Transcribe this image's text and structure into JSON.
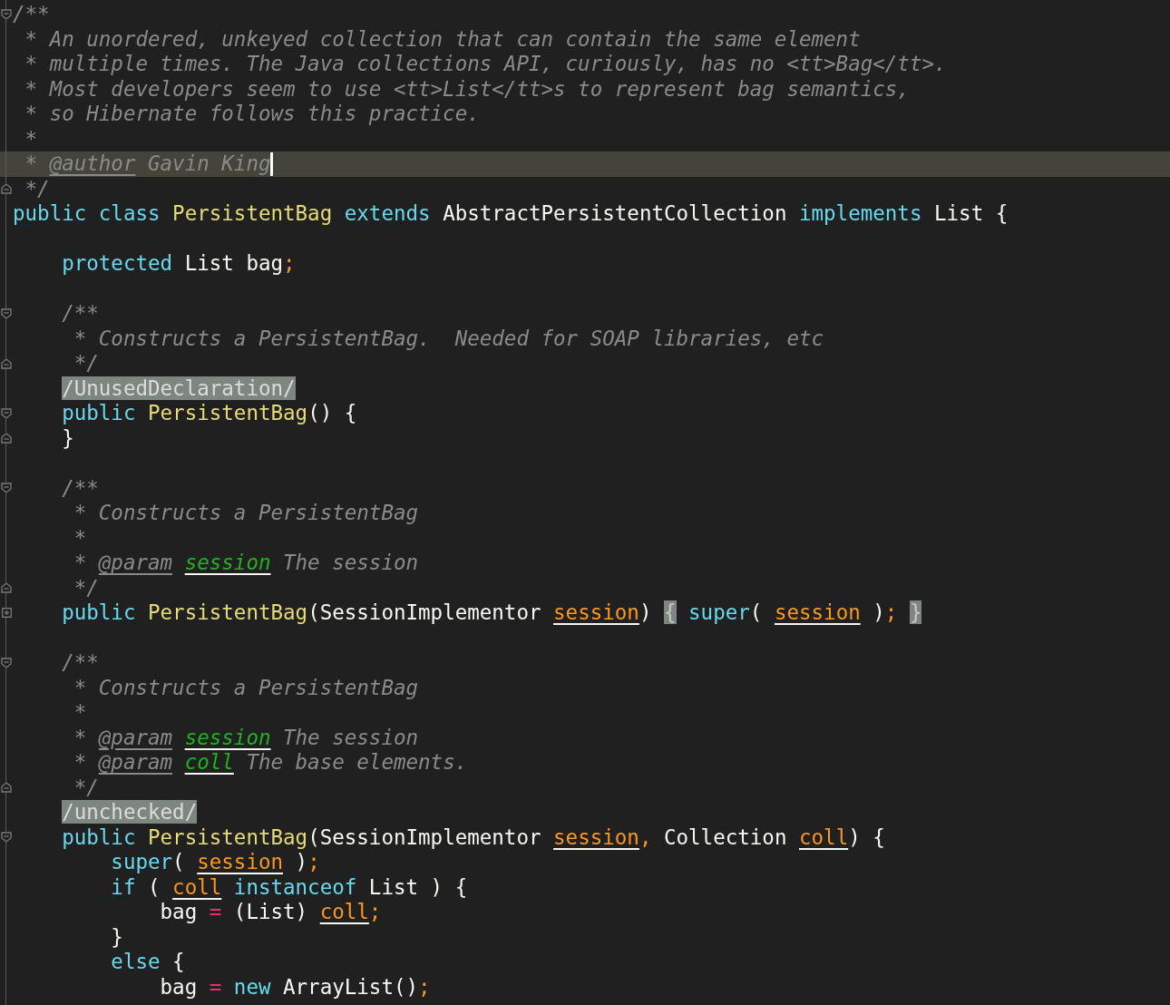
{
  "editor": {
    "lines": [
      {
        "kind": "fold-start",
        "current": false,
        "tokens": [
          {
            "text": "/**",
            "kind": "comment"
          }
        ]
      },
      {
        "kind": "plain",
        "current": false,
        "tokens": [
          {
            "text": " * An unordered, unkeyed collection that can contain the same element",
            "kind": "comment"
          }
        ]
      },
      {
        "kind": "plain",
        "current": false,
        "tokens": [
          {
            "text": " * multiple times. The Java collections API, curiously, has no <tt>Bag</tt>.",
            "kind": "comment"
          }
        ]
      },
      {
        "kind": "plain",
        "current": false,
        "tokens": [
          {
            "text": " * Most developers seem to use <tt>List</tt>s to represent bag semantics,",
            "kind": "comment"
          }
        ]
      },
      {
        "kind": "plain",
        "current": false,
        "tokens": [
          {
            "text": " * so Hibernate follows this practice.",
            "kind": "comment"
          }
        ]
      },
      {
        "kind": "plain",
        "current": false,
        "tokens": [
          {
            "text": " *",
            "kind": "comment"
          }
        ]
      },
      {
        "kind": "plain",
        "current": true,
        "tokens": [
          {
            "text": " *",
            "kind": "comment"
          },
          {
            "text": " @author",
            "kind": "doctag"
          },
          {
            "text": " Gavin King",
            "kind": "comment"
          }
        ]
      },
      {
        "kind": "fold-end",
        "current": false,
        "tokens": [
          {
            "text": " */",
            "kind": "comment"
          }
        ]
      },
      {
        "kind": "plain",
        "current": false,
        "tokens": [
          {
            "text": "public",
            "kind": "keyword"
          },
          {
            "text": " class",
            "kind": "keyword"
          },
          {
            "text": " PersistentBag",
            "kind": "type"
          },
          {
            "text": " extends",
            "kind": "keyword"
          },
          {
            "text": " AbstractPersistentCollection",
            "kind": "plain"
          },
          {
            "text": " implements",
            "kind": "keyword"
          },
          {
            "text": " List {",
            "kind": "plain"
          }
        ]
      },
      {
        "kind": "plain",
        "current": false
      },
      {
        "kind": "plain",
        "current": false,
        "tokens": [
          {
            "text": "    protected",
            "kind": "keyword"
          },
          {
            "text": " List bag",
            "kind": "plain"
          },
          {
            "text": ";",
            "kind": "punct"
          }
        ]
      },
      {
        "kind": "plain",
        "current": false
      },
      {
        "kind": "fold-start",
        "current": false,
        "tokens": [
          {
            "text": "    /**",
            "kind": "comment"
          }
        ]
      },
      {
        "kind": "plain",
        "current": false,
        "tokens": [
          {
            "text": "     * Constructs a PersistentBag.  Needed for SOAP libraries, etc",
            "kind": "comment"
          }
        ]
      },
      {
        "kind": "fold-end",
        "current": false,
        "tokens": [
          {
            "text": "     */",
            "kind": "comment"
          }
        ]
      },
      {
        "kind": "plain",
        "current": false,
        "tokens": [
          {
            "text": "    /UnusedDeclaration/",
            "kind": "suppressed"
          }
        ]
      },
      {
        "kind": "fold-start",
        "current": false,
        "tokens": [
          {
            "text": "    public",
            "kind": "keyword"
          },
          {
            "text": " PersistentBag",
            "kind": "type"
          },
          {
            "text": "() {",
            "kind": "plain"
          }
        ]
      },
      {
        "kind": "fold-end",
        "current": false,
        "tokens": [
          {
            "text": "    }",
            "kind": "plain"
          }
        ]
      },
      {
        "kind": "plain",
        "current": false
      },
      {
        "kind": "fold-start",
        "current": false,
        "tokens": [
          {
            "text": "    /**",
            "kind": "comment"
          }
        ]
      },
      {
        "kind": "plain",
        "current": false,
        "tokens": [
          {
            "text": "     * Constructs a PersistentBag",
            "kind": "comment"
          }
        ]
      },
      {
        "kind": "plain",
        "current": false,
        "tokens": [
          {
            "text": "     *",
            "kind": "comment"
          }
        ]
      },
      {
        "kind": "plain",
        "current": false,
        "tokens": [
          {
            "text": "     *",
            "kind": "comment"
          },
          {
            "text": " @param",
            "kind": "doctag"
          },
          {
            "text": " session",
            "kind": "docparam"
          },
          {
            "text": " The session",
            "kind": "comment"
          }
        ]
      },
      {
        "kind": "fold-end",
        "current": false,
        "tokens": [
          {
            "text": "     */",
            "kind": "comment"
          }
        ]
      },
      {
        "kind": "collapsed",
        "current": false,
        "tokens": [
          {
            "text": "    public",
            "kind": "keyword"
          },
          {
            "text": " PersistentBag",
            "kind": "type"
          },
          {
            "text": "(SessionImplementor",
            "kind": "plain"
          },
          {
            "text": " session",
            "kind": "param"
          },
          {
            "text": ")",
            "kind": "plain"
          },
          {
            "text": " {",
            "kind": "folded"
          },
          {
            "text": " super",
            "kind": "keyword"
          },
          {
            "text": "(",
            "kind": "plain"
          },
          {
            "text": " session",
            "kind": "param"
          },
          {
            "text": " )",
            "kind": "plain"
          },
          {
            "text": ";",
            "kind": "punct"
          },
          {
            "text": " }",
            "kind": "folded"
          }
        ]
      },
      {
        "kind": "plain",
        "current": false
      },
      {
        "kind": "fold-start",
        "current": false,
        "tokens": [
          {
            "text": "    /**",
            "kind": "comment"
          }
        ]
      },
      {
        "kind": "plain",
        "current": false,
        "tokens": [
          {
            "text": "     * Constructs a PersistentBag",
            "kind": "comment"
          }
        ]
      },
      {
        "kind": "plain",
        "current": false,
        "tokens": [
          {
            "text": "     *",
            "kind": "comment"
          }
        ]
      },
      {
        "kind": "plain",
        "current": false,
        "tokens": [
          {
            "text": "     *",
            "kind": "comment"
          },
          {
            "text": " @param",
            "kind": "doctag"
          },
          {
            "text": " session",
            "kind": "docparam"
          },
          {
            "text": " The session",
            "kind": "comment"
          }
        ]
      },
      {
        "kind": "plain",
        "current": false,
        "tokens": [
          {
            "text": "     *",
            "kind": "comment"
          },
          {
            "text": " @param",
            "kind": "doctag"
          },
          {
            "text": " coll",
            "kind": "docparam"
          },
          {
            "text": " The base elements.",
            "kind": "comment"
          }
        ]
      },
      {
        "kind": "fold-end",
        "current": false,
        "tokens": [
          {
            "text": "     */",
            "kind": "comment"
          }
        ]
      },
      {
        "kind": "plain",
        "current": false,
        "tokens": [
          {
            "text": "    /unchecked/",
            "kind": "suppressed"
          }
        ]
      },
      {
        "kind": "fold-start",
        "current": false,
        "tokens": [
          {
            "text": "    public",
            "kind": "keyword"
          },
          {
            "text": " PersistentBag",
            "kind": "type"
          },
          {
            "text": "(SessionImplementor",
            "kind": "plain"
          },
          {
            "text": " session",
            "kind": "param"
          },
          {
            "text": ",",
            "kind": "punct"
          },
          {
            "text": " Collection",
            "kind": "plain"
          },
          {
            "text": " coll",
            "kind": "param"
          },
          {
            "text": ") {",
            "kind": "plain"
          }
        ]
      },
      {
        "kind": "plain",
        "current": false,
        "tokens": [
          {
            "text": "        super",
            "kind": "keyword"
          },
          {
            "text": "(",
            "kind": "plain"
          },
          {
            "text": " session",
            "kind": "param"
          },
          {
            "text": " )",
            "kind": "plain"
          },
          {
            "text": ";",
            "kind": "punct"
          }
        ]
      },
      {
        "kind": "plain",
        "current": false,
        "tokens": [
          {
            "text": "        if",
            "kind": "keyword"
          },
          {
            "text": " (",
            "kind": "plain"
          },
          {
            "text": " coll",
            "kind": "param"
          },
          {
            "text": " instanceof",
            "kind": "keyword"
          },
          {
            "text": " List ) {",
            "kind": "plain"
          }
        ]
      },
      {
        "kind": "plain",
        "current": false,
        "tokens": [
          {
            "text": "            bag",
            "kind": "plain"
          },
          {
            "text": " =",
            "kind": "operator"
          },
          {
            "text": " (List)",
            "kind": "plain"
          },
          {
            "text": " coll",
            "kind": "param"
          },
          {
            "text": ";",
            "kind": "punct"
          }
        ]
      },
      {
        "kind": "plain",
        "current": false,
        "tokens": [
          {
            "text": "        }",
            "kind": "plain"
          }
        ]
      },
      {
        "kind": "plain",
        "current": false,
        "tokens": [
          {
            "text": "        else",
            "kind": "keyword"
          },
          {
            "text": " {",
            "kind": "plain"
          }
        ]
      },
      {
        "kind": "plain",
        "current": false,
        "tokens": [
          {
            "text": "            bag",
            "kind": "plain"
          },
          {
            "text": " =",
            "kind": "operator"
          },
          {
            "text": " new",
            "kind": "keyword"
          },
          {
            "text": " ArrayList()",
            "kind": "plain"
          },
          {
            "text": ";",
            "kind": "punct"
          }
        ]
      }
    ]
  }
}
